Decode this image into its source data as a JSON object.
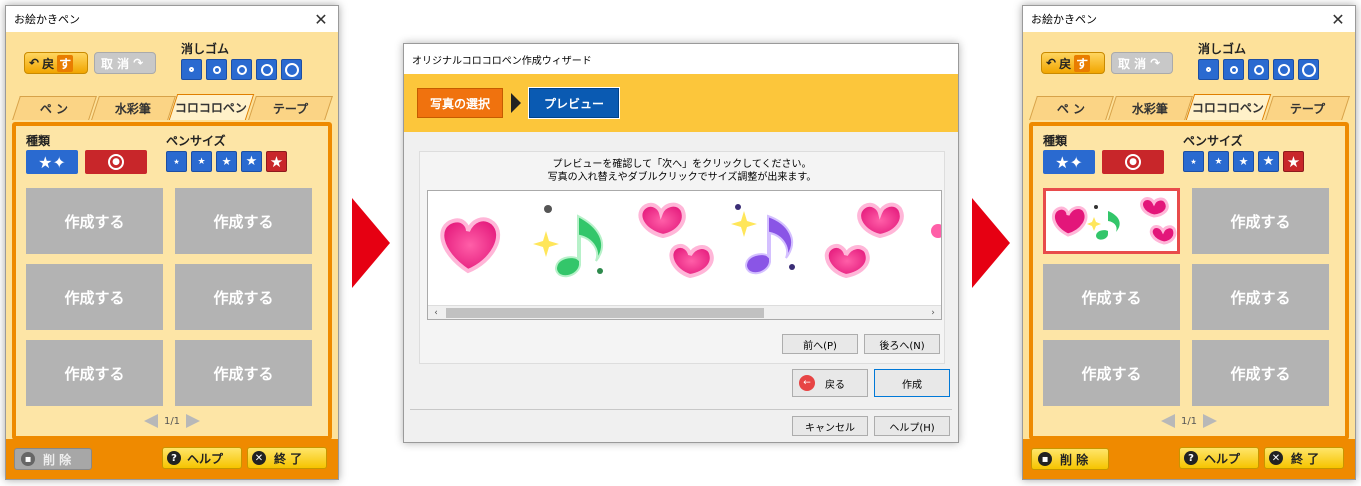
{
  "left_window": {
    "title": "お絵かきペン",
    "back_label": "戻",
    "back_suffix": "す",
    "undo_label": "取 消",
    "eraser_label": "消しゴム",
    "tabs": [
      "ペ ン",
      "水彩筆",
      "コロコロペン",
      "テープ"
    ],
    "active_tab": 2,
    "kind_label": "種類",
    "size_label": "ペンサイズ",
    "cells": [
      "作成する",
      "作成する",
      "作成する",
      "作成する",
      "作成する",
      "作成する"
    ],
    "page": "1/1",
    "delete_label": "削 除",
    "help_label": "ヘルプ",
    "quit_label": "終 了"
  },
  "wizard": {
    "title": "オリジナルコロコロペン作成ウィザード",
    "step1": "写真の選択",
    "step2": "プレビュー",
    "instruction_line1": "プレビューを確認して「次へ」をクリックしてください。",
    "instruction_line2": "写真の入れ替えやダブルクリックでサイズ調整が出来ます。",
    "prev_label": "前へ(P)",
    "next_label": "後ろへ(N)",
    "back_label": "戻る",
    "create_label": "作成",
    "cancel_label": "キャンセル",
    "help_label": "ヘルプ(H)"
  },
  "right_window": {
    "title": "お絵かきペン",
    "back_label": "戻",
    "back_suffix": "す",
    "undo_label": "取 消",
    "eraser_label": "消しゴム",
    "tabs": [
      "ペ ン",
      "水彩筆",
      "コロコロペン",
      "テープ"
    ],
    "active_tab": 2,
    "kind_label": "種類",
    "size_label": "ペンサイズ",
    "cells": [
      "作成する",
      "作成する",
      "作成する",
      "作成する",
      "作成する"
    ],
    "page": "1/1",
    "delete_label": "削 除",
    "help_label": "ヘルプ",
    "quit_label": "終 了"
  },
  "colors": {
    "accent_orange": "#ef8a00",
    "blue": "#2a6ad0",
    "red": "#c8262a",
    "arrow_red": "#e60012",
    "banner": "#fcc63b"
  }
}
